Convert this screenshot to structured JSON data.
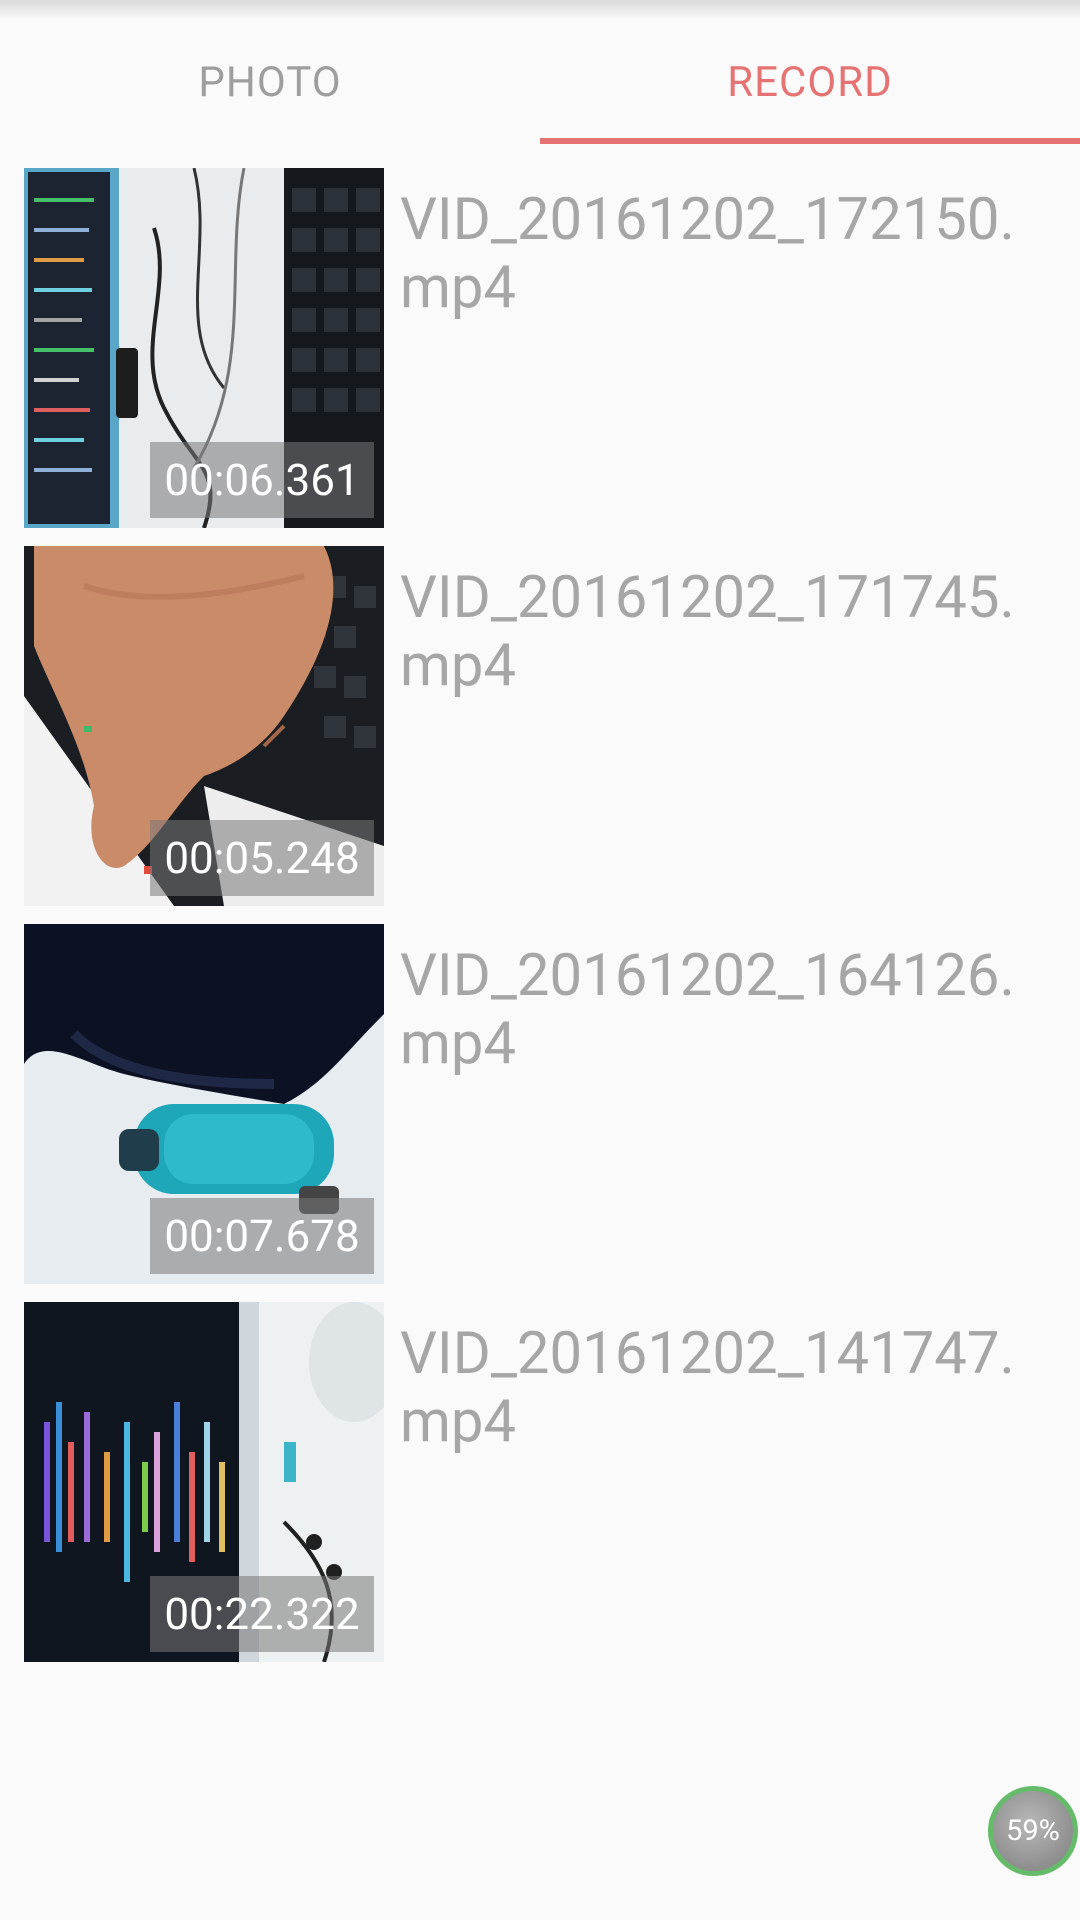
{
  "tabs": [
    {
      "label": "PHOTO",
      "active": false
    },
    {
      "label": "RECORD",
      "active": true
    }
  ],
  "accent_color": "#e57373",
  "videos": [
    {
      "filename": "VID_20161202_172150.mp4",
      "duration": "00:06.361",
      "thumb": "desk-keyboard-cables"
    },
    {
      "filename": "VID_20161202_171745.mp4",
      "duration": "00:05.248",
      "thumb": "hand-over-keyboard"
    },
    {
      "filename": "VID_20161202_164126.mp4",
      "duration": "00:07.678",
      "thumb": "bag-and-water-bottle"
    },
    {
      "filename": "VID_20161202_141747.mp4",
      "duration": "00:22.322",
      "thumb": "monitor-code-screen"
    }
  ],
  "floating_badge": {
    "text": "59%",
    "ring_color": "#66bb6a"
  }
}
